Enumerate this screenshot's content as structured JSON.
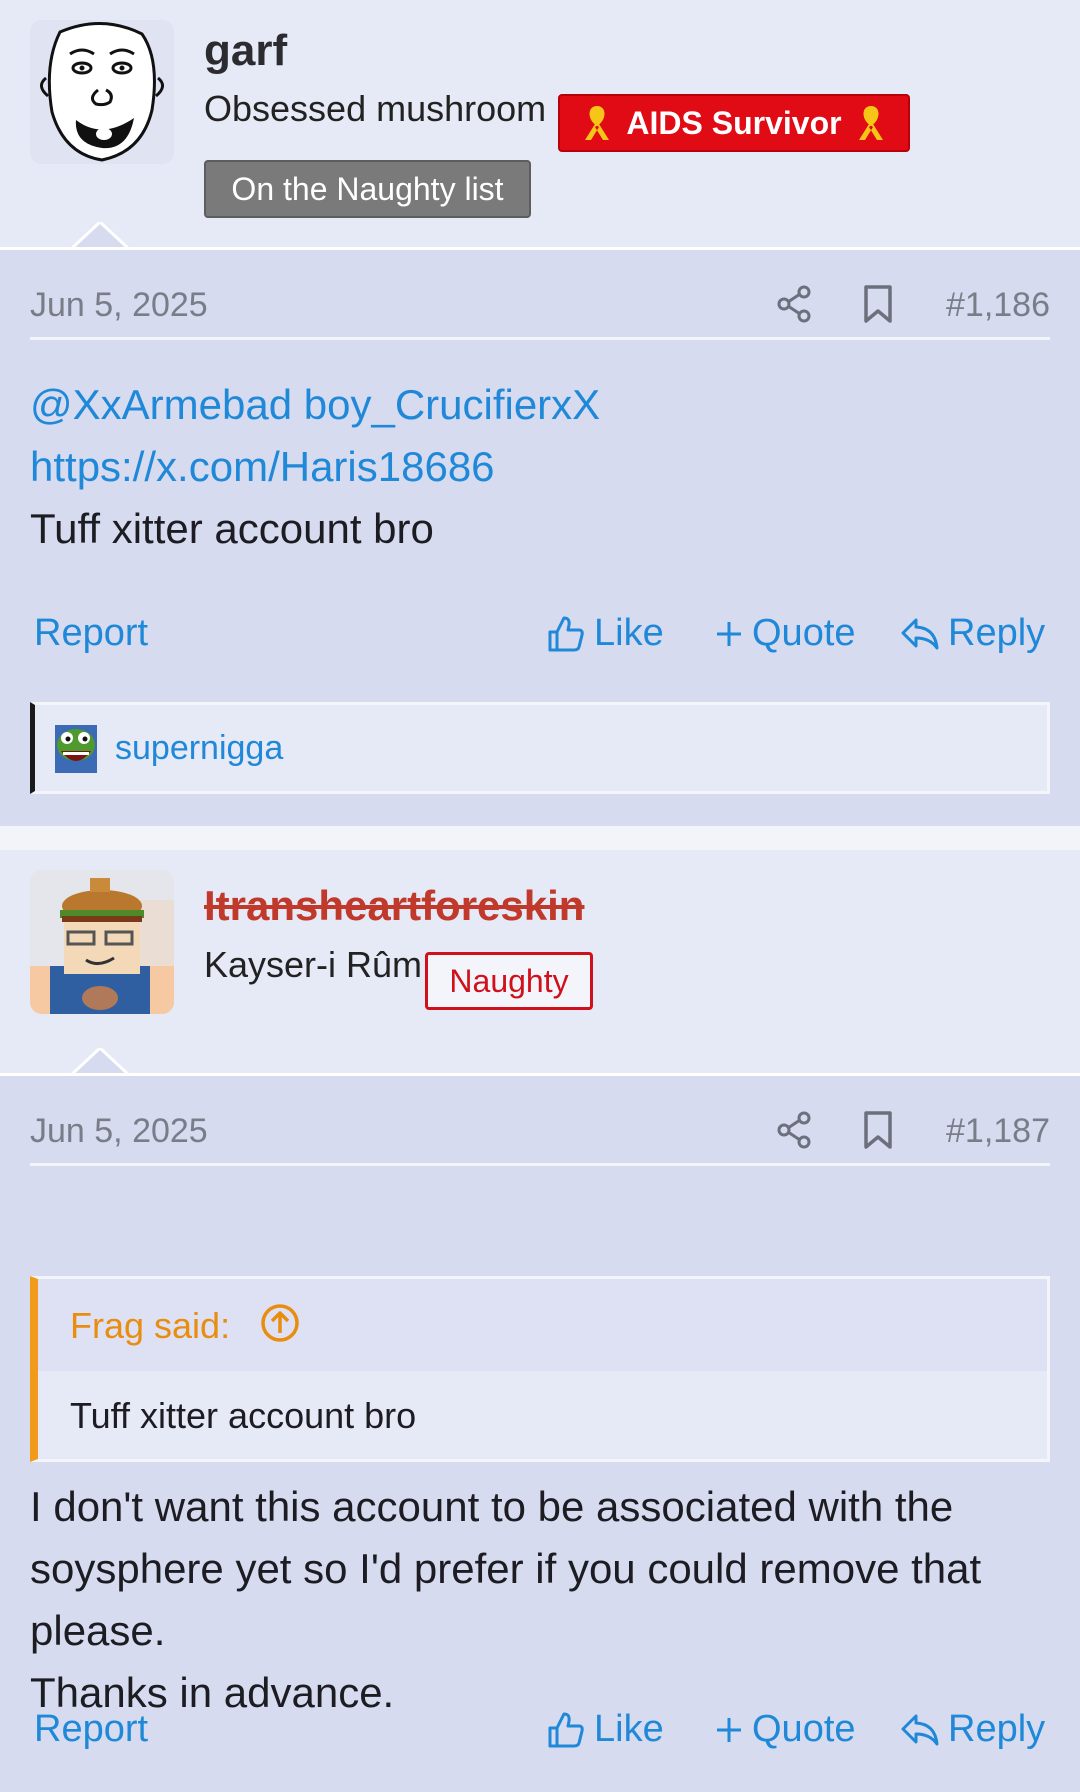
{
  "posts": [
    {
      "username": "garf",
      "user_title": "Obsessed mushroom",
      "badges": [
        "AIDS Survivor",
        "On the Naughty list"
      ],
      "date": "Jun 5, 2025",
      "post_number": "#1,186",
      "body": {
        "mention": "@XxArmebad boy_CrucifierxX",
        "url": "https://x.com/Haris18686",
        "text": "Tuff xitter account bro"
      },
      "actions": {
        "report": "Report",
        "like": "Like",
        "quote": "Quote",
        "reply": "Reply"
      },
      "reactions": {
        "user": "supernigga"
      }
    },
    {
      "username": "Itransheartforeskin",
      "user_title": "Kayser-i Rûm",
      "badges": [
        "Naughty"
      ],
      "date": "Jun 5, 2025",
      "post_number": "#1,187",
      "quote": {
        "author": "Frag said:",
        "text": "Tuff xitter account bro"
      },
      "body": {
        "line1": "I don't want this account to be associated with the",
        "line2": "soysphere yet so I'd prefer if you could remove that",
        "line3": "please.",
        "line4": "Thanks in advance."
      },
      "actions": {
        "report": "Report",
        "like": "Like",
        "quote": "Quote",
        "reply": "Reply"
      }
    }
  ],
  "colors": {
    "link": "#1f88d8",
    "aids_badge": "#e00b14",
    "naughty_list_badge": "#7a7a7a",
    "naughty_badge": "#d0101a",
    "quote_accent": "#f29a1b",
    "post_body_bg": "#d6dbef",
    "header_bg": "#e6e9f6"
  },
  "icons": {
    "ribbon": "awareness-ribbon-icon",
    "share": "share-icon",
    "bookmark": "bookmark-icon",
    "like": "thumbs-up-icon",
    "quote": "plus-icon",
    "reply": "reply-arrow-icon",
    "quote_jump": "arrow-up-circle-icon"
  }
}
